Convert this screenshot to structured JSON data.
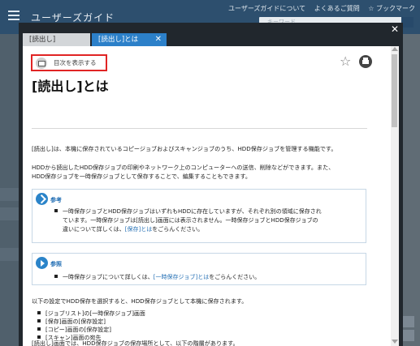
{
  "background": {
    "title": "ユーザーズガイド",
    "links": [
      "ユーザーズガイドについて",
      "よくあるご質問",
      "☆ ブックマーク"
    ],
    "search_placeholder": "キーワード"
  },
  "tabs": [
    {
      "label": "[読出し]",
      "active": false
    },
    {
      "label": "[読出し]とは",
      "active": true
    }
  ],
  "toolbar": {
    "toc_label": "目次を表示する",
    "favorite_icon": "star-icon",
    "print_icon": "print-icon"
  },
  "page": {
    "title": "[読出し]とは",
    "intro": "[読出し]は、本機に保存されているコピージョブおよびスキャンジョブのうち、HDD保存ジョブを管理する機能です。",
    "p2_lines": [
      "HDDから読出したHDD保存ジョブの印刷やネットワーク上のコンピューターへの送信、削除などができます。また、",
      "HDD保存ジョブを一時保存ジョブとして保存することで、編集することもできます。"
    ],
    "notes": [
      {
        "heading": "参考",
        "lines": [
          "一時保存ジョブとHDD保存ジョブはいずれもHDDに存在していますが、それぞれ別の領域に保存され",
          "ています。一時保存ジョブは[読出し]画面には表示されません。一時保存ジョブとHDD保存ジョブの",
          "違いについて詳しくは、",
          "[保存]とは",
          "をごらんください。"
        ]
      },
      {
        "heading": "参照",
        "lines": [
          "一時保存ジョブについて詳しくは、",
          "[一時保存ジョブ]とは",
          "をごらんください。"
        ]
      }
    ],
    "p3": "以下の設定でHDD保存を選択すると、HDD保存ジョブとして本機に保存されます。",
    "list": [
      "[ジョブリスト]の[一時保存ジョブ]画面",
      "[保存]画面の[保存設定]",
      "[コピー]画面の[保存設定]",
      "[スキャン]画面の宛先"
    ],
    "p4": "[読出し]画面では、HDD保存ジョブの保存場所として、以下の階層があります。"
  },
  "colors": {
    "header_bg": "#2d4f6e",
    "active_tab": "#2c80c9",
    "accent": "#2570b5",
    "highlight_border": "#e02424"
  }
}
